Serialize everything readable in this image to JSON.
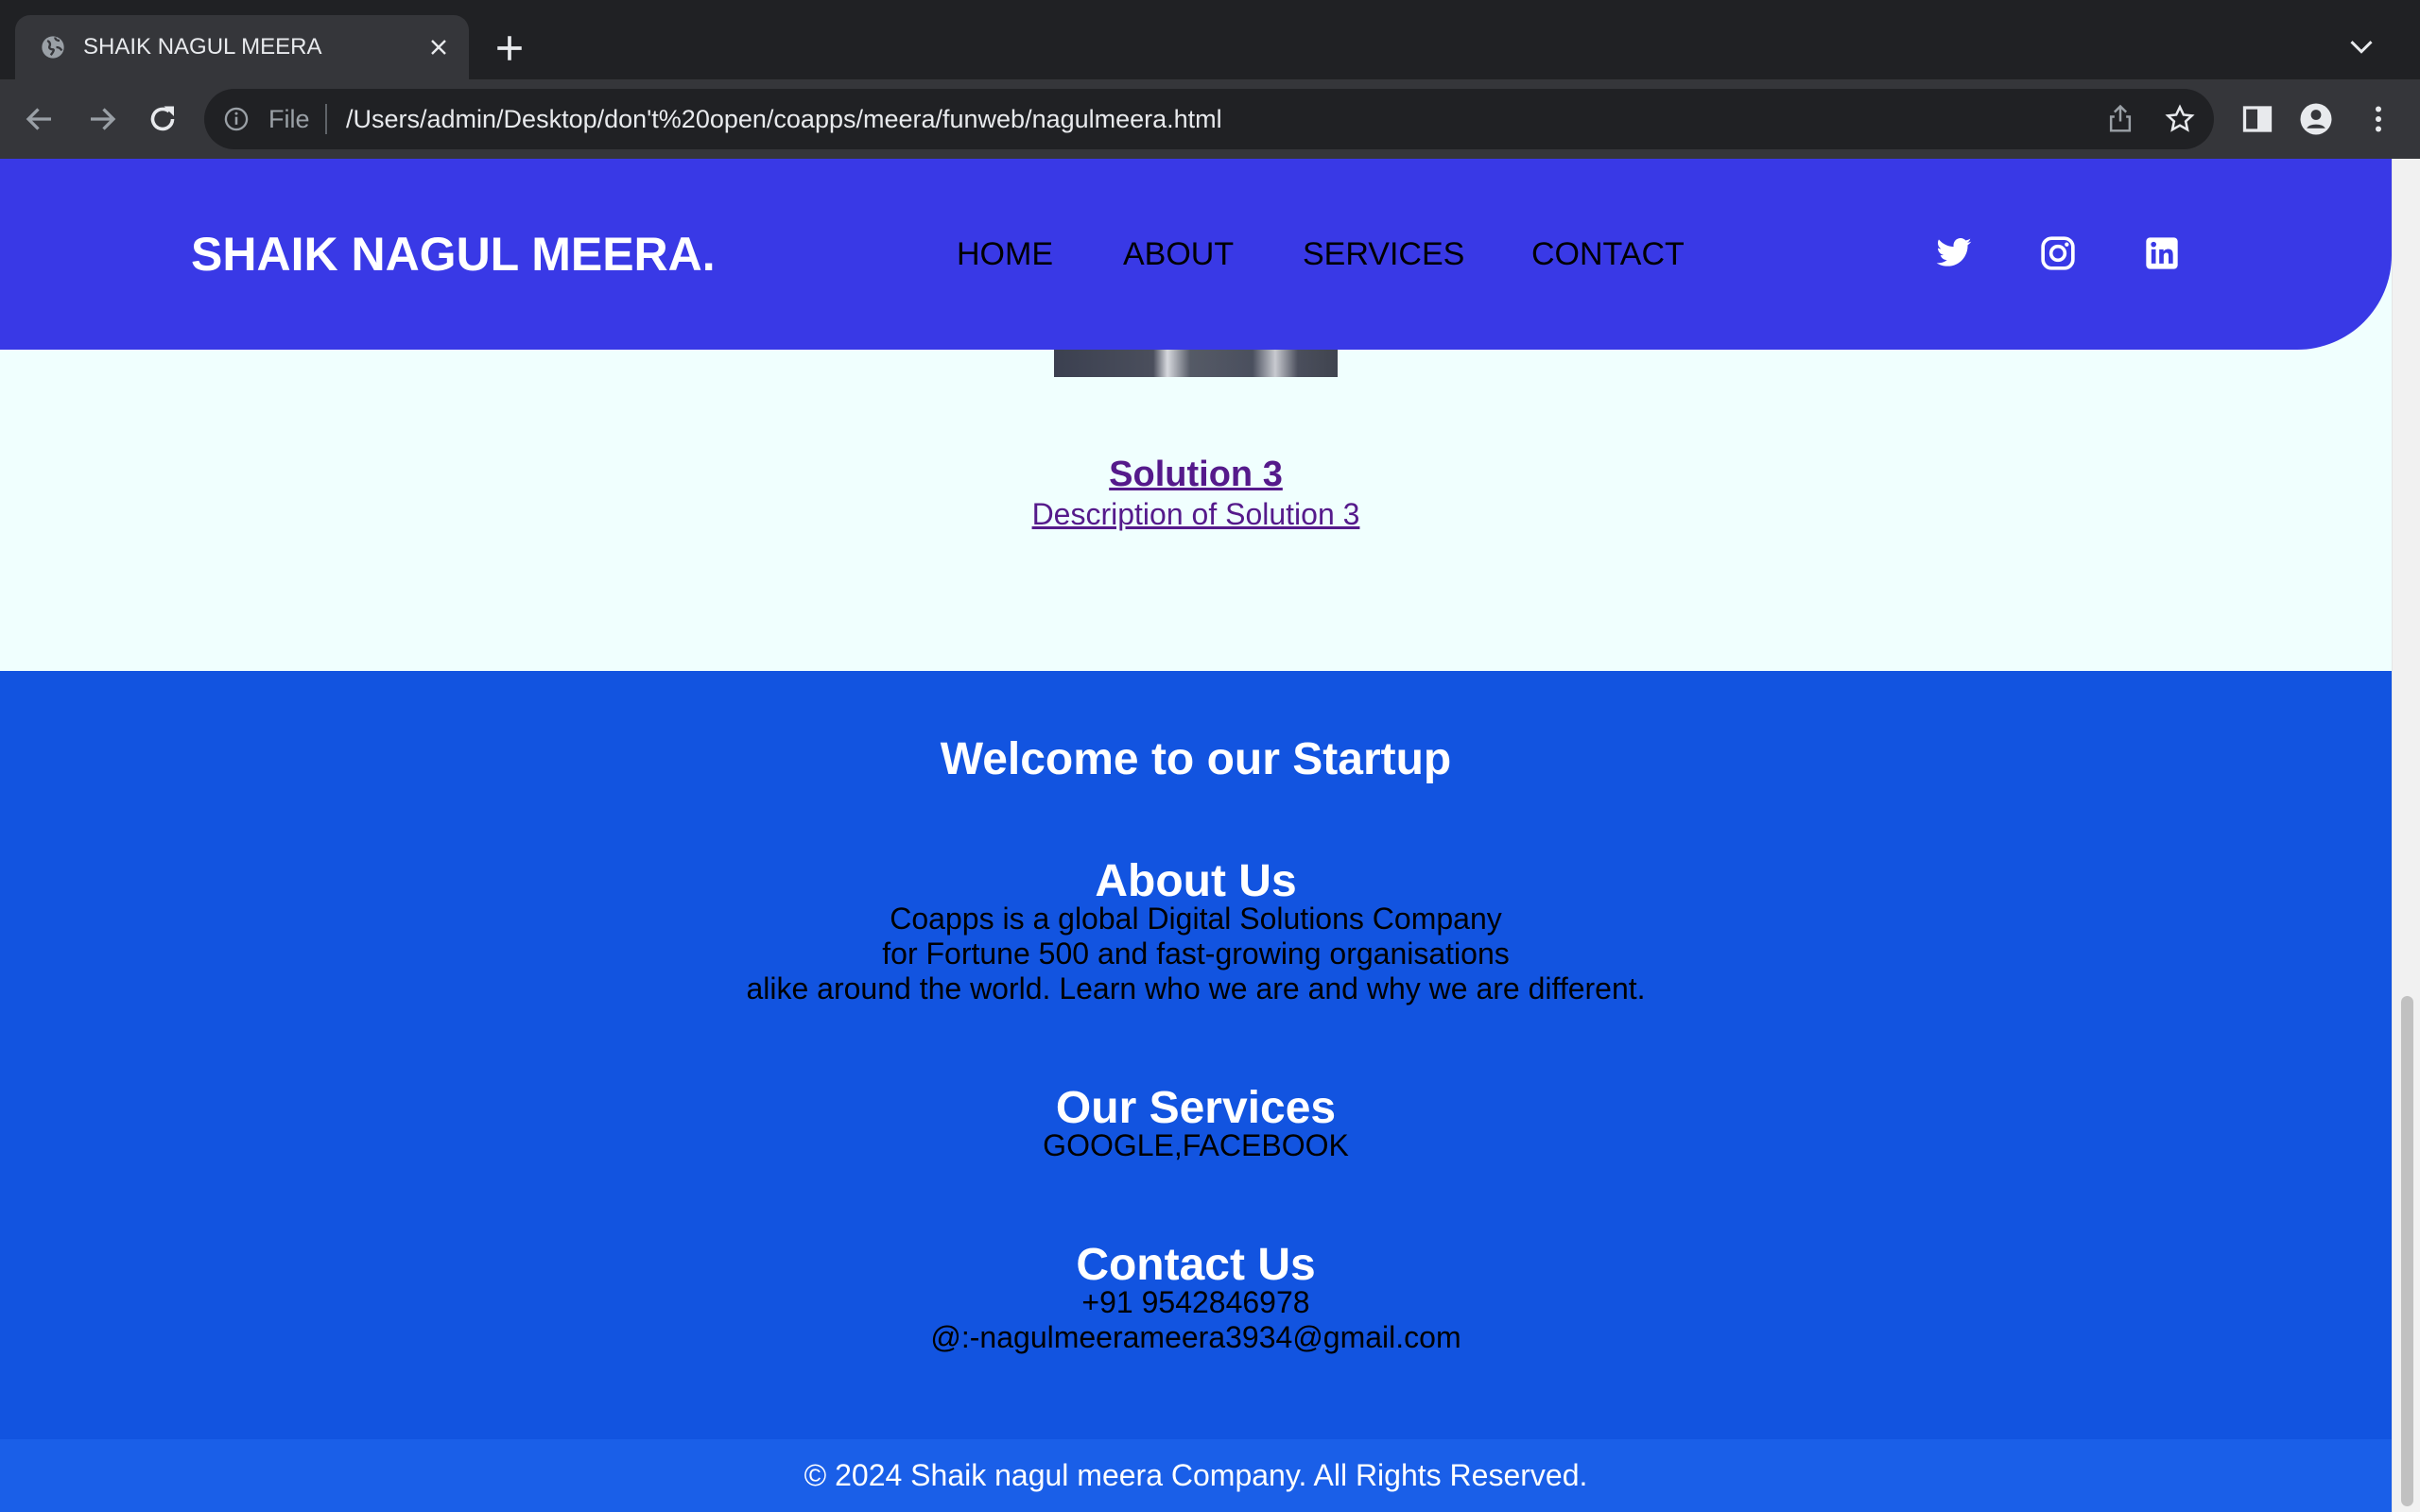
{
  "browser": {
    "tab_title": "SHAIK NAGUL MEERA",
    "omnibox_scheme": "File",
    "url": "/Users/admin/Desktop/don't%20open/coapps/meera/funweb/nagulmeera.html"
  },
  "header": {
    "brand": "SHAIK NAGUL MEERA.",
    "nav": [
      "HOME",
      "ABOUT",
      "SERVICES",
      "CONTACT"
    ],
    "social_icons": [
      "twitter-icon",
      "instagram-icon",
      "linkedin-icon"
    ],
    "background": "#3939e6"
  },
  "solution": {
    "title": "Solution 3",
    "description": "Description of Solution 3"
  },
  "footer": {
    "welcome": "Welcome to our Startup",
    "about_heading": "About Us",
    "about_lines": [
      "Coapps is a global Digital Solutions Company",
      "for Fortune 500 and fast-growing organisations",
      "alike around the world. Learn who we are and why we are different."
    ],
    "services_heading": "Our Services",
    "services_text": "GOOGLE,FACEBOOK",
    "contact_heading": "Contact Us",
    "contact_phone": "+91 9542846978",
    "contact_email": "@:-nagulmeerameera3934@gmail.com",
    "copyright": "© 2024 Shaik nagul meera Company. All Rights Reserved.",
    "background": "#1254e0"
  }
}
